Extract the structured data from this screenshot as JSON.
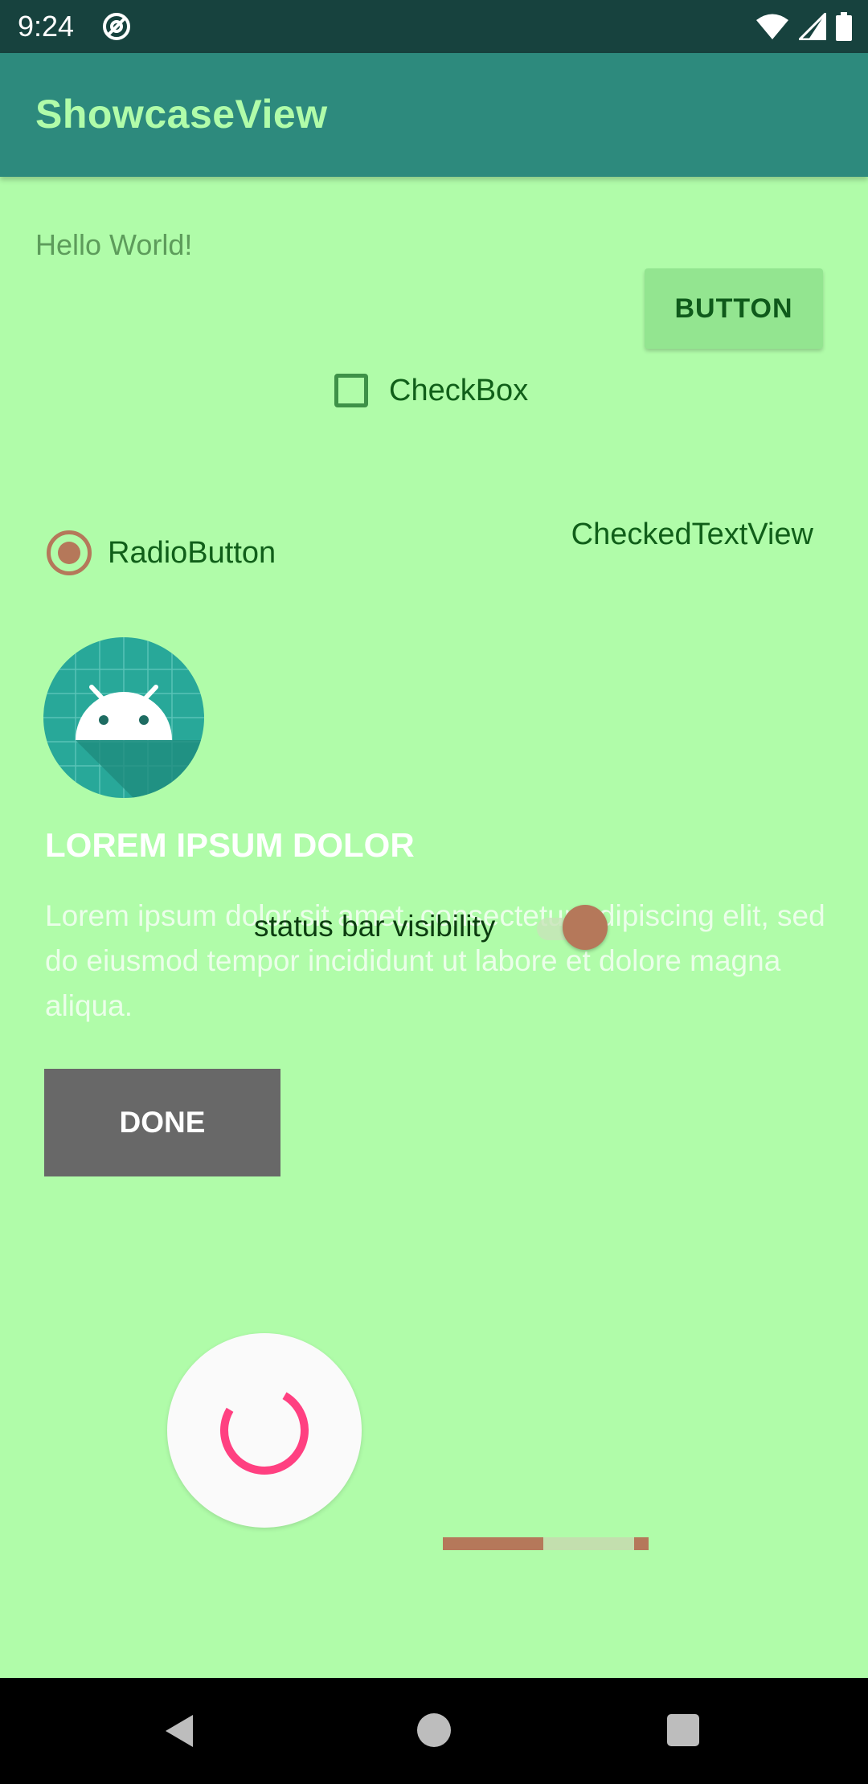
{
  "status_bar": {
    "time": "9:24",
    "left_icon": "vpn-at-icon",
    "right_icons": [
      "wifi-icon",
      "signal-icon",
      "battery-icon"
    ]
  },
  "app_bar": {
    "title": "ShowcaseView"
  },
  "content": {
    "hello_text": "Hello World!",
    "button_label": "BUTTON",
    "checkbox": {
      "label": "CheckBox",
      "checked": false
    },
    "checked_text_view": "CheckedTextView",
    "radio_button": {
      "label": "RadioButton",
      "selected": true
    },
    "switch": {
      "label": "status bar visibility",
      "on": true
    },
    "progress_bar": {
      "primary_fraction": 0.49
    }
  },
  "showcase": {
    "title": "LOREM IPSUM DOLOR",
    "body": "Lorem ipsum dolor sit amet, consectetur adipiscing elit, sed do eiusmod tempor incididunt ut labore et dolore magna aliqua.",
    "done_label": "DONE"
  },
  "colors": {
    "background": "#b0fca9",
    "app_bar": "#2d8a7d",
    "status_bar": "#17423e",
    "accent": "#b5785a",
    "spinner": "#ff4081"
  },
  "nav_bar": {
    "icons": [
      "back-icon",
      "home-icon",
      "recents-icon"
    ]
  }
}
